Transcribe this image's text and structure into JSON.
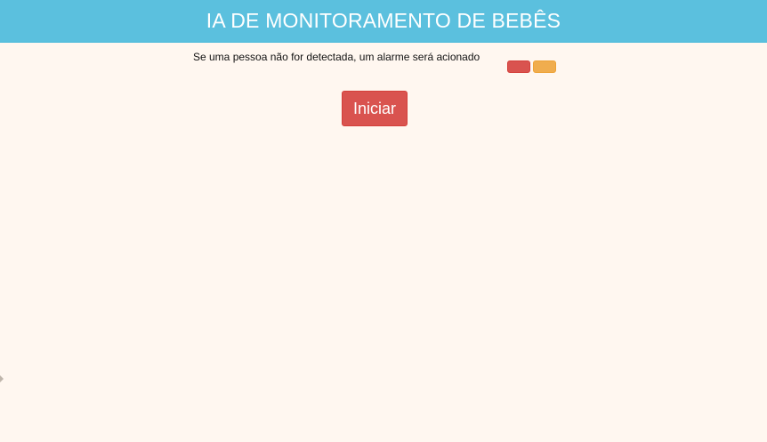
{
  "header": {
    "title": "IA DE MONITORAMENTO DE BEBÊS"
  },
  "info": {
    "text": "Se uma pessoa não for detectada, um alarme será acionado",
    "buttons": [
      {
        "name": "red",
        "color": "#d9534f"
      },
      {
        "name": "orange",
        "color": "#f0ad4e"
      }
    ]
  },
  "actions": {
    "start_label": "Iniciar"
  },
  "colors": {
    "header_bg": "#5bc0de",
    "page_bg": "#fff7f0",
    "danger": "#d9534f",
    "warning": "#f0ad4e"
  }
}
